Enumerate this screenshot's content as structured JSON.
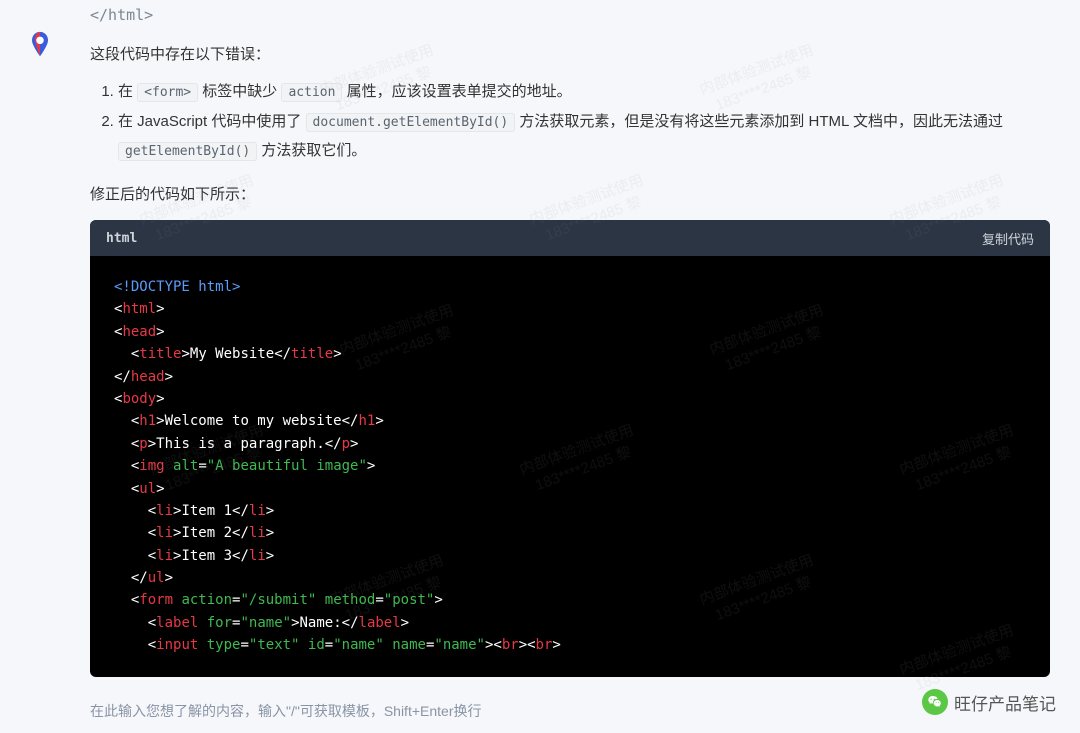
{
  "top_fragment": "</html>",
  "intro": "这段代码中存在以下错误：",
  "errors": {
    "item1_prefix": "在 ",
    "item1_code1": "<form>",
    "item1_mid": " 标签中缺少 ",
    "item1_code2": "action",
    "item1_suffix": " 属性，应该设置表单提交的地址。",
    "item2_prefix": "在 JavaScript 代码中使用了 ",
    "item2_code1": "document.getElementById()",
    "item2_mid": " 方法获取元素，但是没有将这些元素添加到 HTML 文档中，因此无法通过 ",
    "item2_code2": "getElementById()",
    "item2_suffix": " 方法获取它们。"
  },
  "corrected_label": "修正后的代码如下所示：",
  "code_header": {
    "lang": "html",
    "copy": "复制代码"
  },
  "code_lines": {
    "doctype": "<!DOCTYPE html>",
    "html_open": "html",
    "head_open": "head",
    "title_text": "My Website",
    "title_tag": "title",
    "head_close": "head",
    "body_open": "body",
    "h1_tag": "h1",
    "h1_text": "Welcome to my website",
    "p_tag": "p",
    "p_text": "This is a paragraph.",
    "img_tag": "img",
    "img_attr": "alt",
    "img_val": "\"A beautiful image\"",
    "ul_tag": "ul",
    "li_tag": "li",
    "li1": "Item 1",
    "li2": "Item 2",
    "li3": "Item 3",
    "form_tag": "form",
    "form_action_attr": "action",
    "form_action_val": "\"/submit\"",
    "form_method_attr": "method",
    "form_method_val": "\"post\"",
    "label_tag": "label",
    "label_for_attr": "for",
    "label_for_val": "\"name\"",
    "label_text": "Name:",
    "input_tag": "input",
    "input_type_attr": "type",
    "input_type_val": "\"text\"",
    "input_id_attr": "id",
    "input_id_val": "\"name\"",
    "input_name_attr": "name",
    "input_name_val": "\"name\"",
    "br_tag": "br"
  },
  "input_placeholder": "在此输入您想了解的内容，输入\"/\"可获取模板，Shift+Enter换行",
  "wechat_name": "旺仔产品笔记",
  "watermark_line1": "内部体验测试使用",
  "watermark_line2": "183****2485 黎"
}
